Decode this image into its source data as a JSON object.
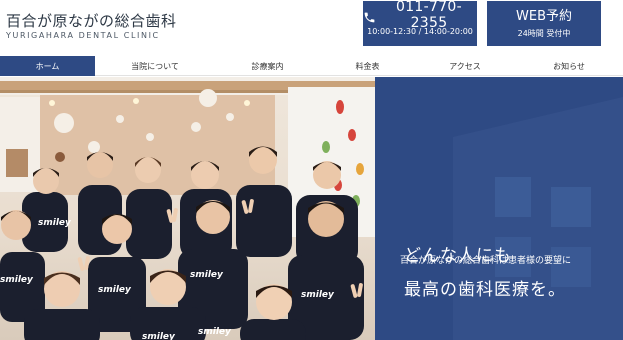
{
  "header": {
    "logo_jp": "百合が原ながの総合歯科",
    "logo_en": "YURIGAHARA DENTAL CLINIC",
    "tel": {
      "number": "011-770-2355",
      "hours": "10:00-12:30 / 14:00-20:00",
      "icon": "phone-icon"
    },
    "web": {
      "title": "WEB予約",
      "sub": "24時間 受付中"
    }
  },
  "nav": {
    "items": [
      {
        "label": "ホーム",
        "active": true
      },
      {
        "label": "当院について",
        "active": false
      },
      {
        "label": "診療案内",
        "active": false
      },
      {
        "label": "料金表",
        "active": false
      },
      {
        "label": "アクセス",
        "active": false
      },
      {
        "label": "お知らせ",
        "active": false
      }
    ]
  },
  "hero": {
    "line1": "どんな人にも",
    "line2": "最高の歯科医療を。",
    "description": "百合が原ながの総合歯科は患者様の要望に",
    "shirt_text": "smiley"
  },
  "colors": {
    "brand_navy": "#2e4a84",
    "shirt": "#1b1f2e",
    "nav_text": "#333333"
  }
}
